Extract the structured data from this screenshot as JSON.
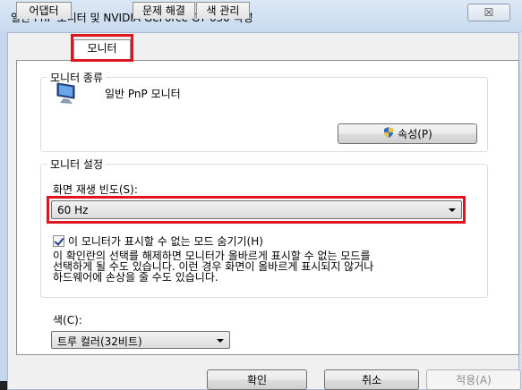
{
  "window": {
    "title": "일반 PnP 모니터 및 NVIDIA GeForce GT 630  속성",
    "close_glyph": "☒"
  },
  "tabs": [
    {
      "label": "어댑터"
    },
    {
      "label": "모니터",
      "active": true
    },
    {
      "label": "문제 해결"
    },
    {
      "label": "색 관리"
    }
  ],
  "monitor_type": {
    "group_label": "모니터 종류",
    "monitor_name": "일반 PnP 모니터",
    "properties_button": "속성(P)"
  },
  "monitor_settings": {
    "group_label": "모니터 설정",
    "refresh_label": "화면 재생 빈도(S):",
    "refresh_value": "60 Hz",
    "hide_modes_label": "이 모니터가 표시할 수 없는 모드 숨기기(H)",
    "hide_modes_checked": true,
    "warning_text": "이 확인란의 선택를 해제하면 모니터가 올바르게 표시할 수 없는 모드를\n선택하게 될 수도 있습니다. 이런 경우 화면이 올바르게 표시되지 않거나\n하드웨어에 손상을 줄 수도 있습니다.",
    "color_label": "색(C):",
    "color_value": "트루 컬러(32비트)"
  },
  "footer": {
    "ok": "확인",
    "cancel": "취소",
    "apply": "적용(A)"
  },
  "colors": {
    "highlight": "#e0141e",
    "title_bg": "#cfe0f2"
  }
}
